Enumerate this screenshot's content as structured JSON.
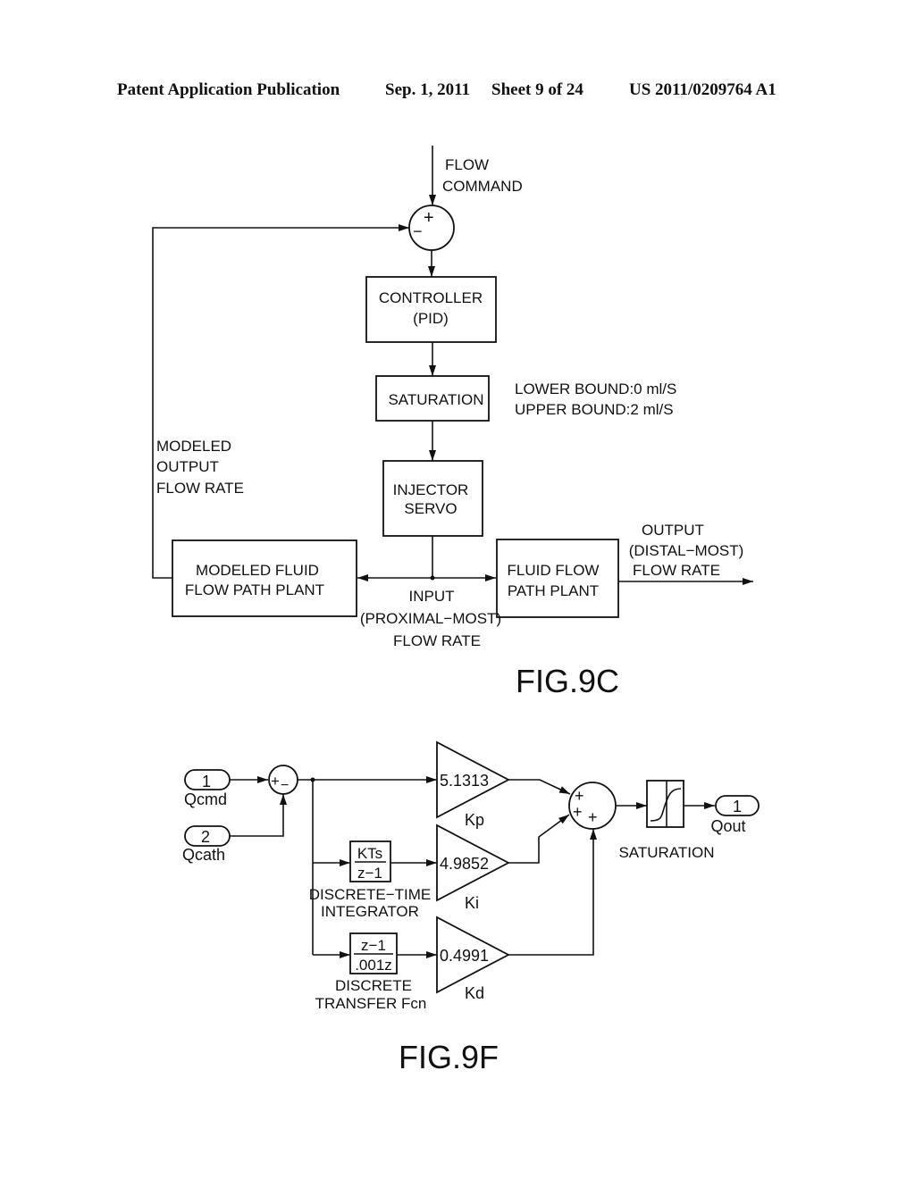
{
  "header": {
    "publication": "Patent Application Publication",
    "date": "Sep. 1, 2011",
    "sheet": "Sheet 9 of 24",
    "number": "US 2011/0209764 A1"
  },
  "fig9c": {
    "label": "FIG.9C",
    "flow_command": [
      "FLOW",
      "COMMAND"
    ],
    "summer_signs": {
      "plus": "+",
      "minus": "−"
    },
    "controller": [
      "CONTROLLER",
      "(PID)"
    ],
    "saturation": "SATURATION",
    "bounds": [
      "LOWER BOUND:0 ml/S",
      "UPPER BOUND:2 ml/S"
    ],
    "injector": [
      "INJECTOR",
      "SERVO"
    ],
    "modeled_output": [
      "MODELED",
      "OUTPUT",
      "FLOW RATE"
    ],
    "modeled_plant": [
      "MODELED FLUID",
      "FLOW PATH PLANT"
    ],
    "input_rate": [
      "INPUT",
      "(PROXIMAL−MOST)",
      "FLOW RATE"
    ],
    "plant": [
      "FLUID FLOW",
      "PATH PLANT"
    ],
    "output_rate": [
      "OUTPUT",
      "(DISTAL−MOST)",
      "FLOW RATE"
    ]
  },
  "fig9f": {
    "label": "FIG.9F",
    "inports": [
      {
        "num": "1",
        "name": "Qcmd"
      },
      {
        "num": "2",
        "name": "Qcath"
      }
    ],
    "sum1_signs": [
      "+",
      "−"
    ],
    "integrator": {
      "num": "KTs",
      "den": "z−1",
      "caption": [
        "DISCRETE−TIME",
        "INTEGRATOR"
      ]
    },
    "derivative": {
      "num": "z−1",
      "den": ".001z",
      "caption": [
        "DISCRETE",
        "TRANSFER Fcn"
      ]
    },
    "gains": [
      {
        "value": "5.1313",
        "name": "Kp"
      },
      {
        "value": "4.9852",
        "name": "Ki"
      },
      {
        "value": "0.4991",
        "name": "Kd"
      }
    ],
    "sum2_signs": [
      "+",
      "+",
      "+"
    ],
    "saturation": "SATURATION",
    "outport": {
      "num": "1",
      "name": "Qout"
    }
  }
}
